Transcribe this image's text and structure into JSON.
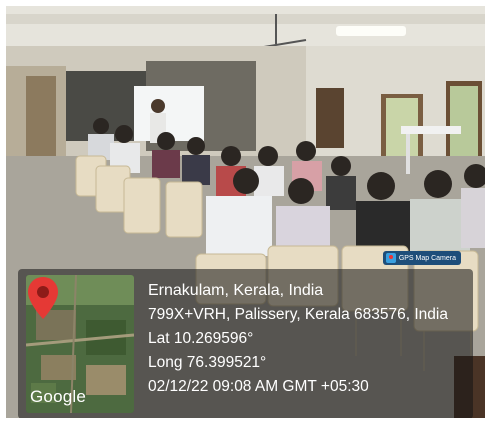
{
  "photo": {
    "description_icon": "classroom-scene"
  },
  "geotag": {
    "camera_badge": "GPS Map Camera",
    "map_brand": "Google",
    "location_title": "Ernakulam, Kerala, India",
    "address": "799X+VRH, Palissery, Kerala 683576, India",
    "latitude": "Lat 10.269596°",
    "longitude": "Long 76.399521°",
    "datetime": "02/12/22 09:08 AM GMT +05:30"
  },
  "colors": {
    "overlay": "#141414",
    "pin": "#e53935",
    "badge": "#1e4e7a"
  }
}
